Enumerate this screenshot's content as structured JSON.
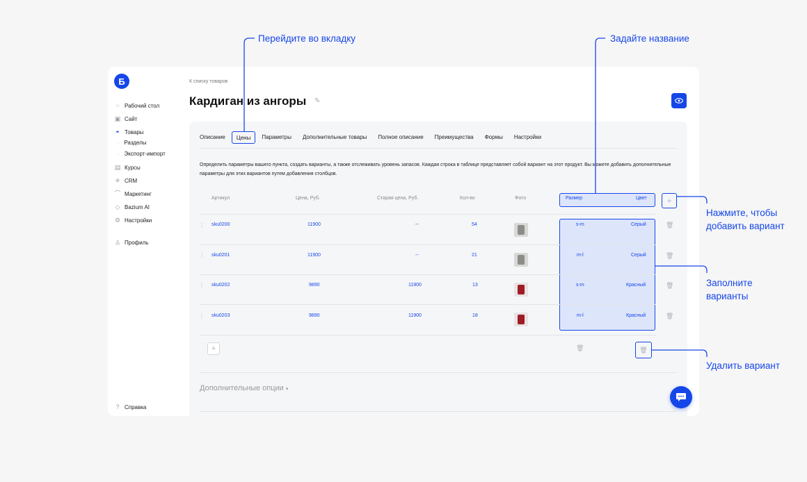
{
  "sidebar": {
    "logo": "Б",
    "items": [
      {
        "label": "Рабочий стол",
        "icon": "dashboard-icon"
      },
      {
        "label": "Сайт",
        "icon": "layout-icon"
      },
      {
        "label": "Товары",
        "icon": "bag-icon"
      },
      {
        "label": "Курсы",
        "icon": "book-icon"
      },
      {
        "label": "CRM",
        "icon": "crm-icon"
      },
      {
        "label": "Маркетинг",
        "icon": "chart-icon"
      },
      {
        "label": "Bazium AI",
        "icon": "ai-icon"
      },
      {
        "label": "Настройки",
        "icon": "gear-icon"
      },
      {
        "label": "Профиль",
        "icon": "user-icon"
      },
      {
        "label": "Справка",
        "icon": "help-icon"
      }
    ],
    "sub_items": [
      "Разделы",
      "Экспорт-импорт"
    ]
  },
  "breadcrumb": "К списку товаров",
  "page_title": "Кардиган из ангоры",
  "tabs": [
    "Описание",
    "Цены",
    "Параметры",
    "Дополнительные товары",
    "Полное описание",
    "Преимущества",
    "Формы",
    "Настройки"
  ],
  "description": "Определить параметры вашего пункта, создать варианты, а также отслеживать уровень запасов. Каждая строка в таблице представляет собой вариант на этот продукт. Вы можете добавить дополнительные параметры для этих вариантов путем добавления столбцов.",
  "table": {
    "headers": [
      "Артикул",
      "Цена, Руб.",
      "Старая цена, Руб.",
      "Кол-во",
      "Фото",
      "Размер",
      "Цвет"
    ],
    "rows": [
      {
        "sku": "sku0200",
        "price": "11900",
        "old_price": "--",
        "qty": "54",
        "photo": "gray",
        "size": "s-m",
        "color": "Серый"
      },
      {
        "sku": "sku0201",
        "price": "11900",
        "old_price": "--",
        "qty": "21",
        "photo": "gray",
        "size": "m-l",
        "color": "Серый"
      },
      {
        "sku": "sku0202",
        "price": "9890",
        "old_price": "11900",
        "qty": "13",
        "photo": "red",
        "size": "s-m",
        "color": "Красный"
      },
      {
        "sku": "sku0203",
        "price": "9890",
        "old_price": "11900",
        "qty": "18",
        "photo": "red",
        "size": "m-l",
        "color": "Красный"
      }
    ]
  },
  "extra_options": "Дополнительные опции",
  "callouts": {
    "go_to_tab": "Перейдите во вкладку",
    "set_name": "Задайте название",
    "add_variant": "Нажмите, чтобы\nдобавить вариант",
    "fill_variants": "Заполните\nварианты",
    "delete_variant": "Удалить вариант"
  },
  "colors": {
    "accent": "#1546e8",
    "highlight": "#dde5fb"
  }
}
